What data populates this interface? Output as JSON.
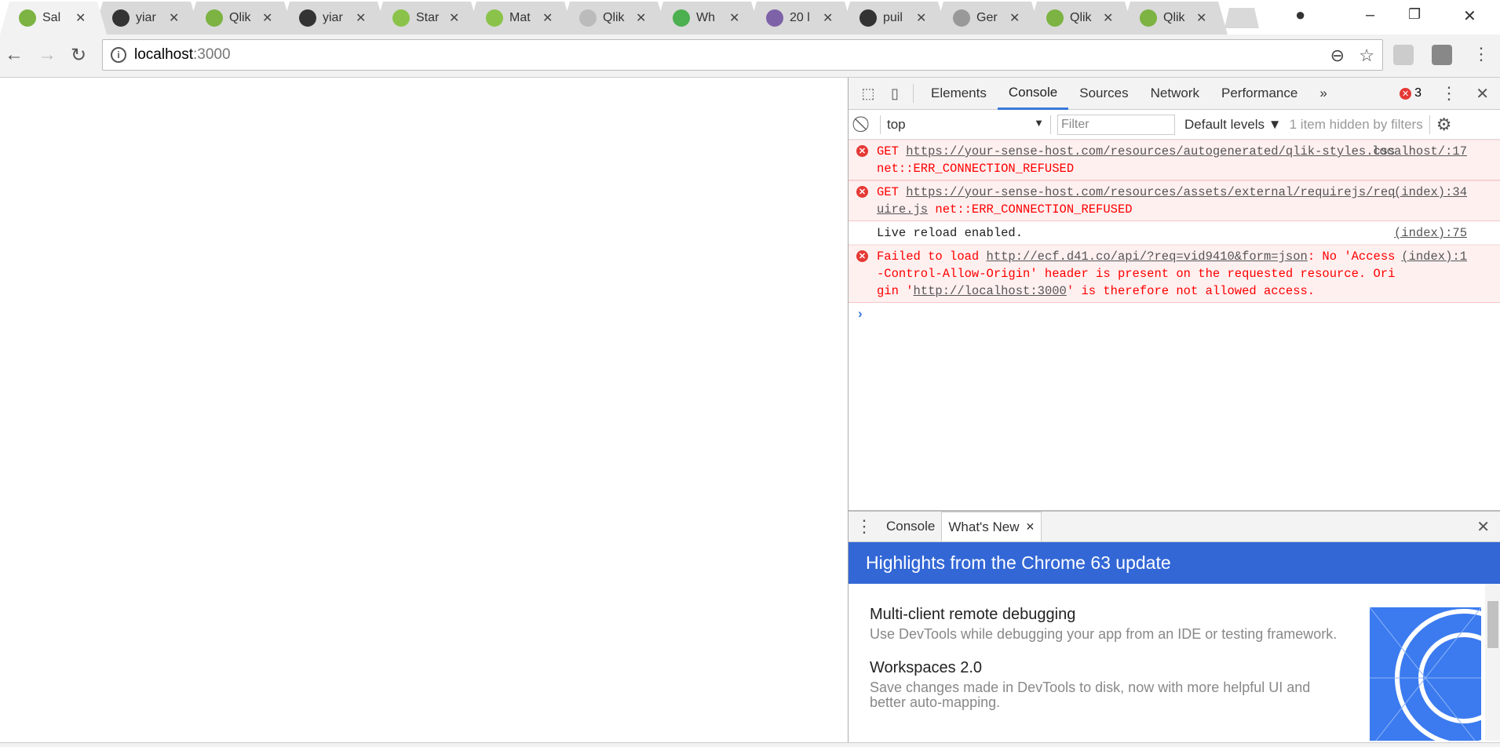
{
  "browser": {
    "tabs": [
      {
        "title": "Sal",
        "icon": "qlik-icon",
        "color": "#7cb342",
        "active": true
      },
      {
        "title": "yiar",
        "icon": "github-icon",
        "color": "#333333"
      },
      {
        "title": "Qlik",
        "icon": "qlik-icon",
        "color": "#7cb342"
      },
      {
        "title": "yiar",
        "icon": "github-icon",
        "color": "#333333"
      },
      {
        "title": "Star",
        "icon": "qlik-s-icon",
        "color": "#8bc34a"
      },
      {
        "title": "Mat",
        "icon": "qlik-s-icon",
        "color": "#8bc34a"
      },
      {
        "title": "Qlik",
        "icon": "document-icon",
        "color": "#bbbbbb"
      },
      {
        "title": "Wh",
        "icon": "whatsapp-icon",
        "color": "#4caf50"
      },
      {
        "title": "20 l",
        "icon": "colorlib-icon",
        "color": "#7e62a8"
      },
      {
        "title": "puil",
        "icon": "github-icon",
        "color": "#333333"
      },
      {
        "title": "Ger",
        "icon": "wordpress-icon",
        "color": "#999999"
      },
      {
        "title": "Qlik",
        "icon": "qlik-icon",
        "color": "#7cb342"
      },
      {
        "title": "Qlik",
        "icon": "qlik-icon",
        "color": "#7cb342"
      }
    ],
    "url_host": "localhost",
    "url_port": ":3000"
  },
  "devtools": {
    "tabs": [
      "Elements",
      "Console",
      "Sources",
      "Network",
      "Performance"
    ],
    "active_tab": "Console",
    "more": "»",
    "error_count": "3",
    "context": "top",
    "filter_placeholder": "Filter",
    "levels": "Default levels ▼",
    "hidden_info": "1 item hidden by filters",
    "messages": [
      {
        "type": "error",
        "pre": "GET ",
        "link": "https://your-sense-host.com/resources/autogenerated/qlik-styles.css",
        "post": " net::ERR_CONNECTION_REFUSED",
        "source": "localhost/:17"
      },
      {
        "type": "error",
        "pre": "GET ",
        "link": "https://your-sense-host.com/resources/assets/external/requirejs/require.js",
        "post": " net::ERR_CONNECTION_REFUSED",
        "source": "(index):34"
      },
      {
        "type": "log",
        "text": "Live reload enabled.",
        "source": "(index):75"
      },
      {
        "type": "error",
        "pre": "Failed to load ",
        "link": "http://ecf.d41.co/api/?req=vid9410&form=json",
        "post": ": No 'Access-Control-Allow-Origin' header is present on the requested resource. Origin '",
        "link2": "http://localhost:3000",
        "post2": "' is therefore not allowed access.",
        "source": "(index):1"
      }
    ],
    "drawer": {
      "tabs": [
        "Console",
        "What's New"
      ],
      "active_tab": "What's New",
      "header": "Highlights from the Chrome 63 update",
      "features": [
        {
          "title": "Multi-client remote debugging",
          "desc": "Use DevTools while debugging your app from an IDE or testing framework."
        },
        {
          "title": "Workspaces 2.0",
          "desc": "Save changes made in DevTools to disk, now with more helpful UI and better auto-mapping."
        }
      ]
    }
  }
}
